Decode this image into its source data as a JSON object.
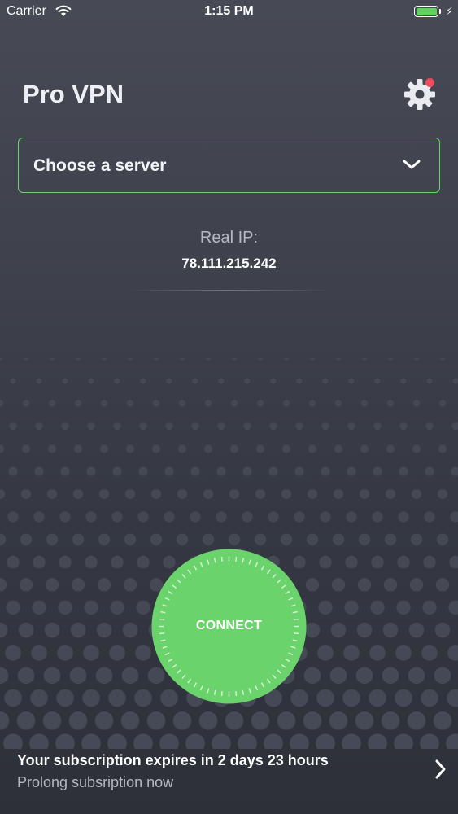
{
  "status_bar": {
    "carrier": "Carrier",
    "time": "1:15 PM",
    "battery_color": "#5fd35b"
  },
  "header": {
    "title": "Pro VPN",
    "settings_icon": "gear-icon",
    "notification_color": "#f04a5c"
  },
  "server_selector": {
    "label": "Choose a server",
    "icon": "chevron-down-icon",
    "border_color": "#6dd36e"
  },
  "ip_info": {
    "label": "Real IP:",
    "value": "78.111.215.242"
  },
  "connect": {
    "label": "CONNECT",
    "color": "#6bd36b"
  },
  "subscription": {
    "title": "Your subscription expires in 2 days 23 hours",
    "link": "Prolong subsription now",
    "icon": "chevron-right-icon"
  }
}
